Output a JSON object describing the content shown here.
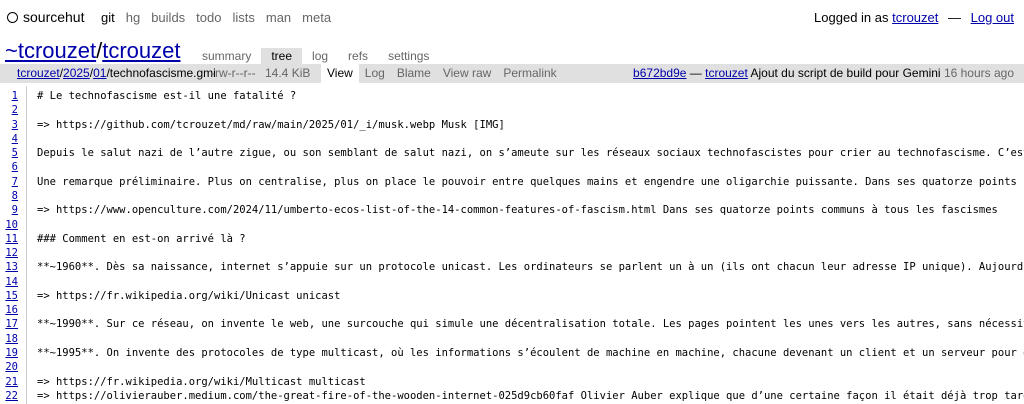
{
  "topnav": {
    "brand": "sourcehut",
    "links": [
      {
        "label": "git",
        "active": true
      },
      {
        "label": "hg",
        "active": false
      },
      {
        "label": "builds",
        "active": false
      },
      {
        "label": "todo",
        "active": false
      },
      {
        "label": "lists",
        "active": false
      },
      {
        "label": "man",
        "active": false
      },
      {
        "label": "meta",
        "active": false
      }
    ],
    "logged_in_prefix": "Logged in as",
    "username": "tcrouzet",
    "separator": "—",
    "logout": "Log out"
  },
  "repo": {
    "owner": "~tcrouzet",
    "slash": "/",
    "name": "tcrouzet",
    "tabs": [
      "summary",
      "tree",
      "log",
      "refs",
      "settings"
    ],
    "active_tab": "tree"
  },
  "file": {
    "path_parts": [
      "tcrouzet",
      "/",
      "2025",
      "/",
      "01",
      "/",
      "technofascisme.gmi"
    ],
    "mode": "-rw-r--r--",
    "size": "14.4 KiB",
    "actions": [
      "View",
      "Log",
      "Blame",
      "View raw",
      "Permalink"
    ],
    "active_action": "View",
    "commit_hash": "b672bd9e",
    "commit_sep": "—",
    "commit_author": "tcrouzet",
    "commit_message": "Ajout du script de build pour Gemini",
    "commit_time": "16 hours ago"
  },
  "lines": [
    {
      "n": "1",
      "text": "# Le technofascisme est-il une fatalité ?"
    },
    {
      "n": "2",
      "text": ""
    },
    {
      "n": "3",
      "text": "=> https://github.com/tcrouzet/md/raw/main/2025/01/_i/musk.webp Musk [IMG]"
    },
    {
      "n": "4",
      "text": ""
    },
    {
      "n": "5",
      "text": "Depuis le salut nazi de l’autre zigue, ou son semblant de salut nazi, on s’ameute sur les réseaux sociaux technofascistes pour crier au technofascisme. C’est bien de s’év"
    },
    {
      "n": "6",
      "text": ""
    },
    {
      "n": "7",
      "text": "Une remarque préliminaire. Plus on centralise, plus on place le pouvoir entre quelques mains et engendre une oligarchie puissante. Dans ses quatorze points communs à tous"
    },
    {
      "n": "8",
      "text": ""
    },
    {
      "n": "9",
      "text": "=> https://www.openculture.com/2024/11/umberto-ecos-list-of-the-14-common-features-of-fascism.html Dans ses quatorze points communs à tous les fascismes"
    },
    {
      "n": "10",
      "text": ""
    },
    {
      "n": "11",
      "text": "### Comment en est-on arrivé là ?"
    },
    {
      "n": "12",
      "text": ""
    },
    {
      "n": "13",
      "text": "**~1960**. Dès sa naissance, internet s’appuie sur un protocole unicast. Les ordinateurs se parlent un à un (ils ont chacun leur adresse IP unique). Aujourd’hui, quand You"
    },
    {
      "n": "14",
      "text": ""
    },
    {
      "n": "15",
      "text": "=> https://fr.wikipedia.org/wiki/Unicast unicast"
    },
    {
      "n": "16",
      "text": ""
    },
    {
      "n": "17",
      "text": "**~1990**. Sur ce réseau, on invente le web, une surcouche qui simule une décentralisation totale. Les pages pointent les unes vers les autres, sans nécessiter une base de"
    },
    {
      "n": "18",
      "text": ""
    },
    {
      "n": "19",
      "text": "**~1995**. On invente des protocoles de type multicast, où les informations s’écoulent de machine en machine, chacune devenant un client et un serveur pour d’autres client"
    },
    {
      "n": "20",
      "text": ""
    },
    {
      "n": "21",
      "text": "=> https://fr.wikipedia.org/wiki/Multicast multicast"
    },
    {
      "n": "22",
      "text": "=> https://olivierauber.medium.com/the-great-fire-of-the-wooden-internet-025d9cb60faf Olivier Auber explique que d’une certaine façon il était déjà trop tard"
    }
  ]
}
